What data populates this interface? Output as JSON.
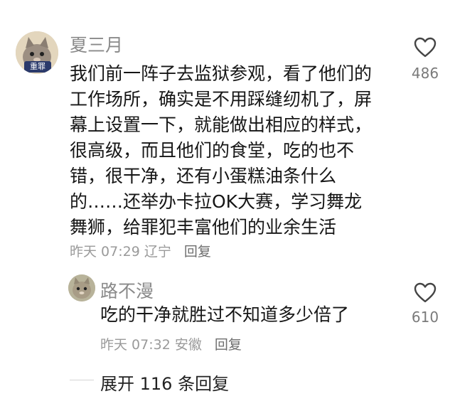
{
  "main_comment": {
    "username": "夏三月",
    "avatar_badge": "重罪",
    "lines": [
      "我们前一阵子去监狱参观，看了他们的",
      "工作场所，确实是不用踩缝纫机了，屏",
      "幕上设置一下，就能做出相应的样式，",
      "很高级，而且他们的食堂，吃的也不",
      "错，很干净，还有小蛋糕油条什么",
      "的……还举办卡拉OK大赛，学习舞龙",
      "舞狮，给罪犯丰富他们的业余生活"
    ],
    "time": "昨天 07:29",
    "location": "辽宁",
    "reply_label": "回复",
    "like_count": "486"
  },
  "reply_comment": {
    "username": "路不漫",
    "text": "吃的干净就胜过不知道多少倍了",
    "time": "昨天 07:32",
    "location": "安徽",
    "reply_label": "回复",
    "like_count": "610"
  },
  "expand": {
    "label": "展开 116 条回复"
  },
  "icons": {
    "like": "heart-outline-icon"
  }
}
